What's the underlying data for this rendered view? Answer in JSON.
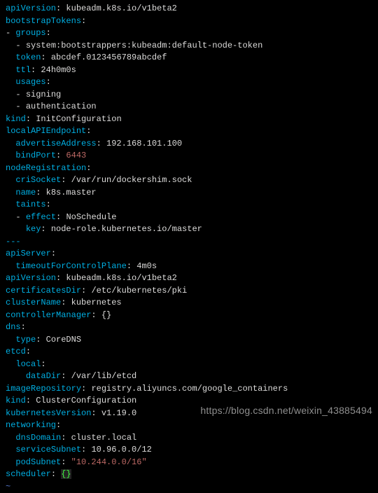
{
  "yaml": {
    "apiVersion1": "kubeadm.k8s.io/v1beta2",
    "bootstrapTokens_key": "bootstrapTokens",
    "groups_key": "groups",
    "group0": "system:bootstrappers:kubeadm:default-node-token",
    "token_key": "token",
    "token_val": "abcdef.0123456789abcdef",
    "ttl_key": "ttl",
    "ttl_val": "24h0m0s",
    "usages_key": "usages",
    "usage0": "signing",
    "usage1": "authentication",
    "kind1_key": "kind",
    "kind1_val": "InitConfiguration",
    "localAPIEndpoint_key": "localAPIEndpoint",
    "advertiseAddress_key": "advertiseAddress",
    "advertiseAddress_val": "192.168.101.100",
    "bindPort_key": "bindPort",
    "bindPort_val": "6443",
    "nodeRegistration_key": "nodeRegistration",
    "criSocket_key": "criSocket",
    "criSocket_val": "/var/run/dockershim.sock",
    "name_key": "name",
    "name_val": "k8s.master",
    "taints_key": "taints",
    "effect_key": "effect",
    "effect_val": "NoSchedule",
    "key_key": "key",
    "key_val": "node-role.kubernetes.io/master",
    "sep": "---",
    "apiServer_key": "apiServer",
    "timeoutForControlPlane_key": "timeoutForControlPlane",
    "timeoutForControlPlane_val": "4m0s",
    "apiVersion2": "kubeadm.k8s.io/v1beta2",
    "certificatesDir_key": "certificatesDir",
    "certificatesDir_val": "/etc/kubernetes/pki",
    "clusterName_key": "clusterName",
    "clusterName_val": "kubernetes",
    "controllerManager_key": "controllerManager",
    "controllerManager_val": "{}",
    "dns_key": "dns",
    "type_key": "type",
    "type_val": "CoreDNS",
    "etcd_key": "etcd",
    "local_key": "local",
    "dataDir_key": "dataDir",
    "dataDir_val": "/var/lib/etcd",
    "imageRepository_key": "imageRepository",
    "imageRepository_val": "registry.aliyuncs.com/google_containers",
    "kind2_val": "ClusterConfiguration",
    "kubernetesVersion_key": "kubernetesVersion",
    "kubernetesVersion_val": "v1.19.0",
    "networking_key": "networking",
    "dnsDomain_key": "dnsDomain",
    "dnsDomain_val": "cluster.local",
    "serviceSubnet_key": "serviceSubnet",
    "serviceSubnet_val": "10.96.0.0/12",
    "podSubnet_key": "podSubnet",
    "podSubnet_val": "\"10.244.0.0/16\"",
    "scheduler_key": "scheduler",
    "scheduler_val": "{}",
    "tilde": "~"
  },
  "watermark": "https://blog.csdn.net/weixin_43885494"
}
